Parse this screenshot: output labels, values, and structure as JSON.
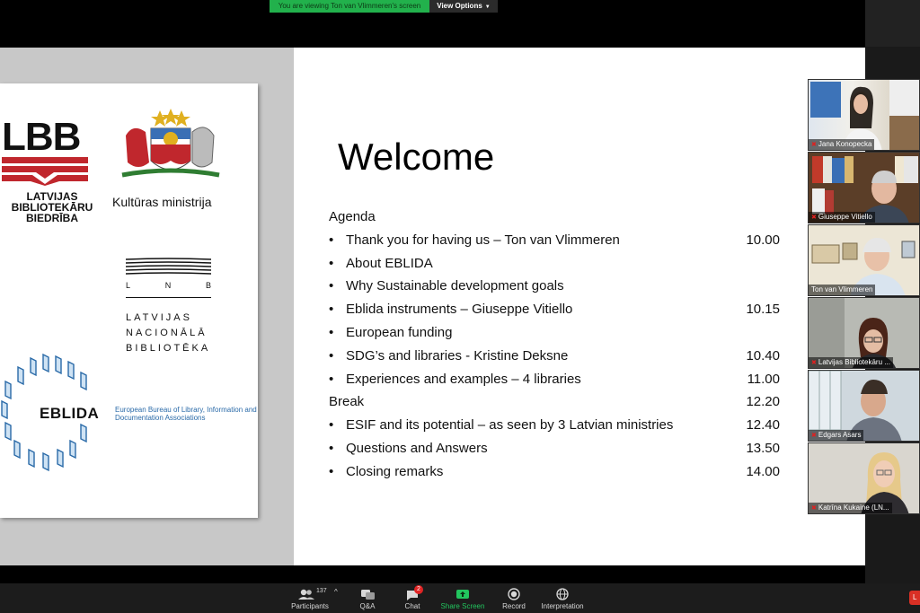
{
  "banner": {
    "viewing_text": "You are viewing Ton van Vlimmeren's screen",
    "view_options_label": "View Options"
  },
  "slide": {
    "logos": {
      "lbb_abbrev": "LBB",
      "lbb_line1": "LATVIJAS",
      "lbb_line2": "BIBLIOTEKĀRU",
      "lbb_line3": "BIEDRĪBA",
      "ministry": "Kultūras ministrija",
      "lnb_l": "L",
      "lnb_n": "N",
      "lnb_b": "B",
      "lnb_line1": "LATVIJAS",
      "lnb_line2": "NACIONĀLĀ",
      "lnb_line3": "BIBLIOTĒKA",
      "eblida": "EBLIDA",
      "eblida_desc": "European Bureau of Library, Information and Documentation Associations"
    },
    "title": "Welcome",
    "agenda_heading": "Agenda",
    "items": [
      {
        "text": "Thank you for having us – Ton van Vlimmeren",
        "time": "10.00",
        "bullet": "•"
      },
      {
        "text": "About EBLIDA",
        "time": "",
        "bullet": "•"
      },
      {
        "text": "Why Sustainable development goals",
        "time": "",
        "bullet": "•"
      },
      {
        "text": "Eblida instruments – Giuseppe Vitiello",
        "time": "10.15",
        "bullet": "•"
      },
      {
        "text": "European funding",
        "time": "",
        "bullet": "•"
      },
      {
        "text": "SDG’s and libraries -  Kristine Deksne",
        "time": "10.40",
        "bullet": "•"
      },
      {
        "text": "Experiences and examples – 4 libraries",
        "time": "11.00",
        "bullet": "•"
      },
      {
        "text": "Break",
        "time": "12.20",
        "bullet": ""
      },
      {
        "text": "ESIF and its potential – as seen by 3 Latvian ministries",
        "time": "12.40",
        "bullet": "•"
      },
      {
        "text": "Questions and Answers",
        "time": "13.50",
        "bullet": "•"
      },
      {
        "text": "Closing remarks",
        "time": "14.00",
        "bullet": "•"
      }
    ]
  },
  "participants": [
    {
      "name": "Jana Konopecka"
    },
    {
      "name": "Giuseppe Vitiello"
    },
    {
      "name": "Ton van Vlimmeren"
    },
    {
      "name": "Latvijas Bibliotekāru ..."
    },
    {
      "name": "Edgars Asars"
    },
    {
      "name": "Katrīna Kukaine  (LN..."
    }
  ],
  "toolbar": {
    "participants_label": "Participants",
    "participants_count": "137",
    "qa_label": "Q&A",
    "chat_label": "Chat",
    "chat_badge": "2",
    "share_label": "Share Screen",
    "record_label": "Record",
    "interpretation_label": "Interpretation",
    "leave_label": "L"
  },
  "colors": {
    "share_green": "#22c55e",
    "banner_green": "#22b14c",
    "lbb_red": "#c0272d",
    "eblida_blue": "#2a6aa8",
    "leave_red": "#d93025"
  }
}
